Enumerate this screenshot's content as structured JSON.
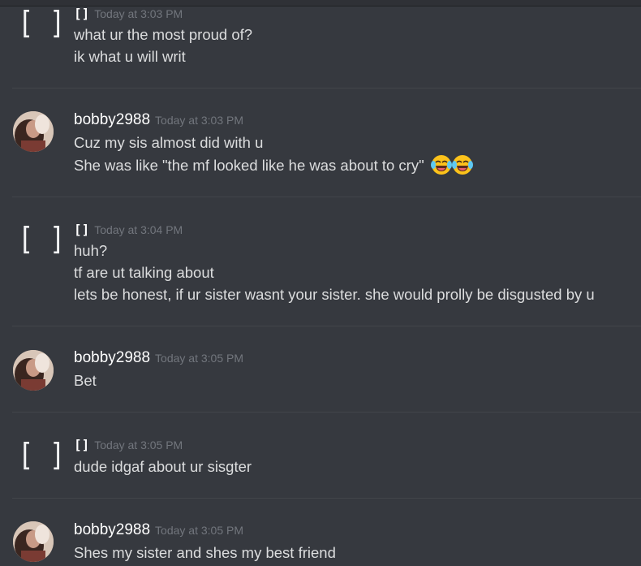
{
  "channel": {
    "messages": [
      {
        "author": "[]",
        "avatar": "bracket-avatar-icon",
        "timestamp": "Today at 3:03 PM",
        "lines": [
          "what ur the most proud of?",
          "ik what u will writ"
        ]
      },
      {
        "author": "bobby2988",
        "avatar": "profile-photo-avatar",
        "timestamp": "Today at 3:03 PM",
        "lines": [
          "Cuz my sis almost did with u",
          "She was like \"the mf looked like he was about to cry\""
        ],
        "emoji": "face-with-tears-of-joy-emoji x2"
      },
      {
        "author": "[]",
        "avatar": "bracket-avatar-icon",
        "timestamp": "Today at 3:04 PM",
        "lines": [
          "huh?",
          "tf are ut talking about",
          "lets be honest, if ur sister wasnt your sister. she would prolly be disgusted by u"
        ]
      },
      {
        "author": "bobby2988",
        "avatar": "profile-photo-avatar",
        "timestamp": "Today at 3:05 PM",
        "lines": [
          "Bet"
        ]
      },
      {
        "author": "[]",
        "avatar": "bracket-avatar-icon",
        "timestamp": "Today at 3:05 PM",
        "lines": [
          "dude idgaf about ur sisgter"
        ]
      },
      {
        "author": "bobby2988",
        "avatar": "profile-photo-avatar",
        "timestamp": "Today at 3:05 PM",
        "lines": [
          "Shes my sister and shes my best friend"
        ]
      }
    ]
  },
  "colors": {
    "background": "#36393f",
    "username": "#ffffff",
    "message_text": "#dcddde",
    "timestamp": "#72767d",
    "divider": "#42454a"
  }
}
